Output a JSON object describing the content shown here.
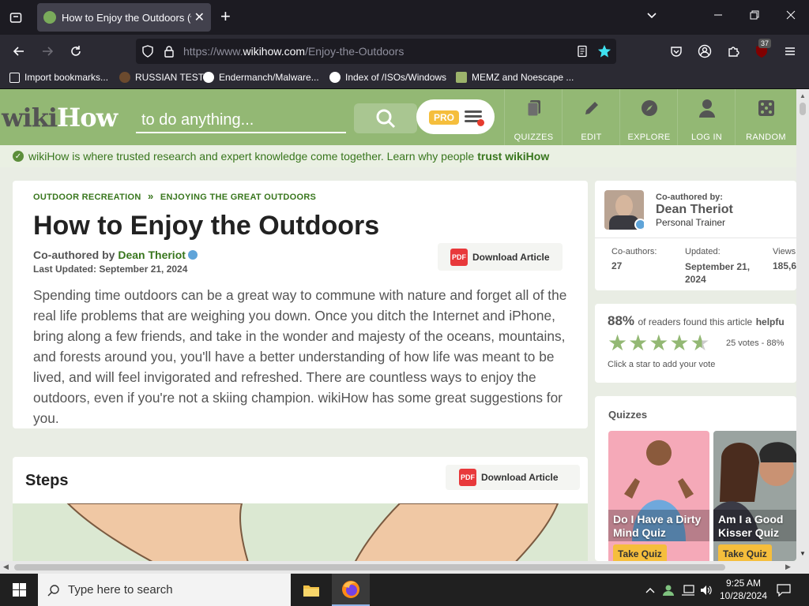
{
  "browser": {
    "tab_title": "How to Enjoy the Outdoors (wit",
    "url_prefix": "https://www.",
    "url_domain": "wikihow.com",
    "url_path": "/Enjoy-the-Outdoors",
    "extension_badge": "37",
    "bookmarks": [
      {
        "label": "Import bookmarks..."
      },
      {
        "label": "RUSSIAN TEST"
      },
      {
        "label": "Endermanch/Malware..."
      },
      {
        "label": "Index of /ISOs/Windows"
      },
      {
        "label": "MEMZ and Noescape ..."
      }
    ]
  },
  "header": {
    "logo_wiki": "wiki",
    "logo_how": "How",
    "search_placeholder": "to do anything...",
    "pro_label": "PRO",
    "nav": [
      {
        "label": "QUIZZES",
        "icon": "quizzes-icon"
      },
      {
        "label": "EDIT",
        "icon": "pencil-icon"
      },
      {
        "label": "EXPLORE",
        "icon": "compass-icon"
      },
      {
        "label": "LOG IN",
        "icon": "user-icon"
      },
      {
        "label": "RANDOM",
        "icon": "dice-icon"
      }
    ]
  },
  "trust": {
    "text": "wikiHow is where trusted research and expert knowledge come together. Learn why people",
    "link": "trust wikiHow"
  },
  "article": {
    "crumb1": "OUTDOOR RECREATION",
    "crumb_sep": "»",
    "crumb2": "ENJOYING THE GREAT OUTDOORS",
    "title": "How to Enjoy the Outdoors",
    "coauth_prefix": "Co-authored by",
    "author": "Dean Theriot",
    "updated": "Last Updated: September 21, 2024",
    "download_label": "Download Article",
    "pdf_label": "PDF",
    "intro": "Spending time outdoors can be a great way to commune with nature and forget all of the real life problems that are weighing you down. Once you ditch the Internet and iPhone, bring along a few friends, and take in the wonder and majesty of the oceans, mountains, and forests around you, you'll have a better understanding of how life was meant to be lived, and will feel invigorated and refreshed. There are countless ways to enjoy the outdoors, even if you're not a skiing champion. wikiHow has some great suggestions for you."
  },
  "steps": {
    "title": "Steps",
    "download_label": "Download Article"
  },
  "sidebar": {
    "coauth_label": "Co-authored by:",
    "author": "Dean Theriot",
    "role": "Personal Trainer",
    "stats": [
      {
        "label": "Co-authors:",
        "value": "27"
      },
      {
        "label": "Updated:",
        "value": "September 21, 2024"
      },
      {
        "label": "Views",
        "value": "185,6"
      }
    ],
    "rating_pct": "88%",
    "rating_text": "of readers found this article",
    "rating_bold": "helpfu",
    "stars_value": 4.5,
    "votes": "25 votes - 88%",
    "click_hint": "Click a star to add your vote",
    "quizzes_title": "Quizzes",
    "quizzes": [
      {
        "title": "Do I Have a Dirty Mind Quiz",
        "button": "Take Quiz"
      },
      {
        "title": "Am I a Good Kisser Quiz",
        "button": "Take Quiz"
      }
    ]
  },
  "taskbar": {
    "search_placeholder": "Type here to search",
    "time": "9:25 AM",
    "date": "10/28/2024"
  },
  "colors": {
    "wikihow_green": "#93b874",
    "link_green": "#38761d",
    "quiz_yellow": "#f5be3c"
  }
}
